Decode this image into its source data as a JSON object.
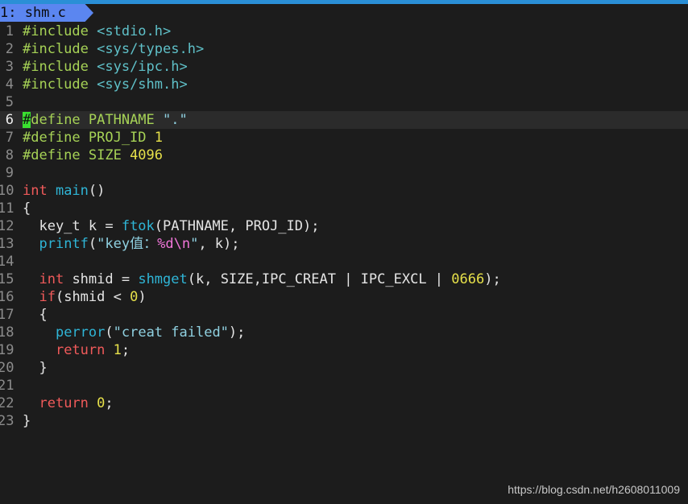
{
  "tab": {
    "label": "1: shm.c"
  },
  "lines": [
    {
      "n": "1",
      "t": [
        {
          "c": "pp",
          "v": "#include "
        },
        {
          "c": "inc",
          "v": "<stdio.h>"
        }
      ]
    },
    {
      "n": "2",
      "t": [
        {
          "c": "pp",
          "v": "#include "
        },
        {
          "c": "inc",
          "v": "<sys/types.h>"
        }
      ]
    },
    {
      "n": "3",
      "t": [
        {
          "c": "pp",
          "v": "#include "
        },
        {
          "c": "inc",
          "v": "<sys/ipc.h>"
        }
      ]
    },
    {
      "n": "4",
      "t": [
        {
          "c": "pp",
          "v": "#include "
        },
        {
          "c": "inc",
          "v": "<sys/shm.h>"
        }
      ]
    },
    {
      "n": "5",
      "t": []
    },
    {
      "n": "6",
      "cur": true,
      "t": [
        {
          "c": "cursor",
          "v": "#"
        },
        {
          "c": "pp",
          "v": "define PATHNAME "
        },
        {
          "c": "str",
          "v": "\".\""
        }
      ]
    },
    {
      "n": "7",
      "t": [
        {
          "c": "pp",
          "v": "#define PROJ_ID "
        },
        {
          "c": "num",
          "v": "1"
        }
      ]
    },
    {
      "n": "8",
      "t": [
        {
          "c": "pp",
          "v": "#define SIZE "
        },
        {
          "c": "num",
          "v": "4096"
        }
      ]
    },
    {
      "n": "9",
      "t": []
    },
    {
      "n": "10",
      "t": [
        {
          "c": "kw",
          "v": "int "
        },
        {
          "c": "fn",
          "v": "main"
        },
        {
          "c": "plain",
          "v": "()"
        }
      ]
    },
    {
      "n": "11",
      "t": [
        {
          "c": "plain",
          "v": "{"
        }
      ]
    },
    {
      "n": "12",
      "t": [
        {
          "c": "plain",
          "v": "  key_t k = "
        },
        {
          "c": "fn",
          "v": "ftok"
        },
        {
          "c": "plain",
          "v": "(PATHNAME, PROJ_ID);"
        }
      ]
    },
    {
      "n": "13",
      "t": [
        {
          "c": "plain",
          "v": "  "
        },
        {
          "c": "fn",
          "v": "printf"
        },
        {
          "c": "plain",
          "v": "("
        },
        {
          "c": "str",
          "v": "\"key值："
        },
        {
          "c": "esc",
          "v": "%d\\n"
        },
        {
          "c": "str",
          "v": "\""
        },
        {
          "c": "plain",
          "v": ", k);"
        }
      ]
    },
    {
      "n": "14",
      "t": []
    },
    {
      "n": "15",
      "t": [
        {
          "c": "plain",
          "v": "  "
        },
        {
          "c": "kw",
          "v": "int "
        },
        {
          "c": "plain",
          "v": "shmid = "
        },
        {
          "c": "fn",
          "v": "shmget"
        },
        {
          "c": "plain",
          "v": "(k, SIZE,IPC_CREAT | IPC_EXCL | "
        },
        {
          "c": "num",
          "v": "0666"
        },
        {
          "c": "plain",
          "v": ");"
        }
      ]
    },
    {
      "n": "16",
      "t": [
        {
          "c": "plain",
          "v": "  "
        },
        {
          "c": "kw",
          "v": "if"
        },
        {
          "c": "plain",
          "v": "(shmid < "
        },
        {
          "c": "num",
          "v": "0"
        },
        {
          "c": "plain",
          "v": ")"
        }
      ]
    },
    {
      "n": "17",
      "t": [
        {
          "c": "plain",
          "v": "  {"
        }
      ]
    },
    {
      "n": "18",
      "t": [
        {
          "c": "plain",
          "v": "    "
        },
        {
          "c": "fn",
          "v": "perror"
        },
        {
          "c": "plain",
          "v": "("
        },
        {
          "c": "str",
          "v": "\"creat failed\""
        },
        {
          "c": "plain",
          "v": ");"
        }
      ]
    },
    {
      "n": "19",
      "t": [
        {
          "c": "plain",
          "v": "    "
        },
        {
          "c": "kw",
          "v": "return "
        },
        {
          "c": "num",
          "v": "1"
        },
        {
          "c": "plain",
          "v": ";"
        }
      ]
    },
    {
      "n": "20",
      "t": [
        {
          "c": "plain",
          "v": "  }"
        }
      ]
    },
    {
      "n": "21",
      "t": []
    },
    {
      "n": "22",
      "t": [
        {
          "c": "plain",
          "v": "  "
        },
        {
          "c": "kw",
          "v": "return "
        },
        {
          "c": "num",
          "v": "0"
        },
        {
          "c": "plain",
          "v": ";"
        }
      ]
    },
    {
      "n": "23",
      "t": [
        {
          "c": "plain",
          "v": "}"
        }
      ]
    }
  ],
  "watermark": "https://blog.csdn.net/h2608011009",
  "colors": {
    "background": "#1c1c1c",
    "tab": "#5b86f0",
    "preprocessor": "#a6d256",
    "keyword": "#f05a5a",
    "function": "#2fb5d6",
    "number": "#e6e04a",
    "cursor": "#3ae030"
  }
}
